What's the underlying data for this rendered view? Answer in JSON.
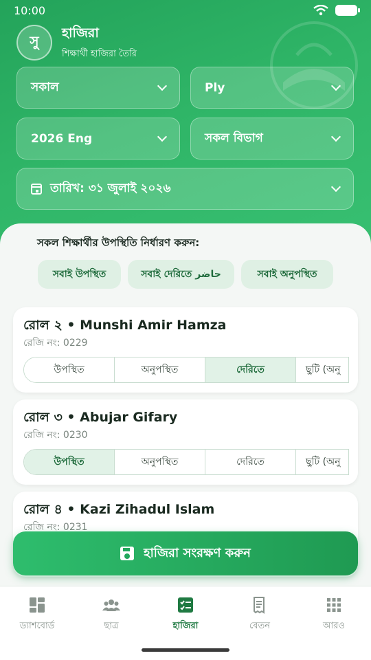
{
  "status_bar": {
    "time": "10:00"
  },
  "header": {
    "avatar_letter": "সু",
    "title": "হাজিরা",
    "subtitle": "শিক্ষার্থী হাজিরা তৈরি"
  },
  "filters": {
    "shift": "সকাল",
    "section": "Ply",
    "session": "2026 Eng",
    "department": "সকল বিভাগ",
    "date": "তারিখ: ৩১ জুলাই ২০২৬"
  },
  "bulk": {
    "label": "সকল শিক্ষার্থীর উপস্থিতি নির্ধারণ করুন:",
    "all_present": "সবাই উপস্থিত",
    "all_late": "সবাই দেরিতে حاضر",
    "all_absent": "সবাই অনুপস্থিত"
  },
  "status_options": [
    "উপস্থিত",
    "অনুপস্থিত",
    "দেরিতে",
    "ছুটি (অনু"
  ],
  "students": [
    {
      "title": "রোল ২ • Munshi Amir Hamza",
      "reg": "রেজি নং: 0229",
      "selected": "দেরিতে"
    },
    {
      "title": "রোল ৩ • Abujar Gifary",
      "reg": "রেজি নং: 0230",
      "selected": "উপস্থিত"
    },
    {
      "title": "রোল ৪ • Kazi Zihadul Islam",
      "reg": "রেজি নং: 0231",
      "selected": ""
    }
  ],
  "save_label": "হাজিরা সংরক্ষণ করুন",
  "nav": {
    "dashboard": "ড্যাশবোর্ড",
    "students": "ছাত্র",
    "attendance": "হাজিরা",
    "salary": "বেতন",
    "more": "আরও"
  },
  "colors": {
    "primary": "#2fb567",
    "accent_dark": "#1f7a42",
    "active_segment": "#e1f2e7"
  }
}
